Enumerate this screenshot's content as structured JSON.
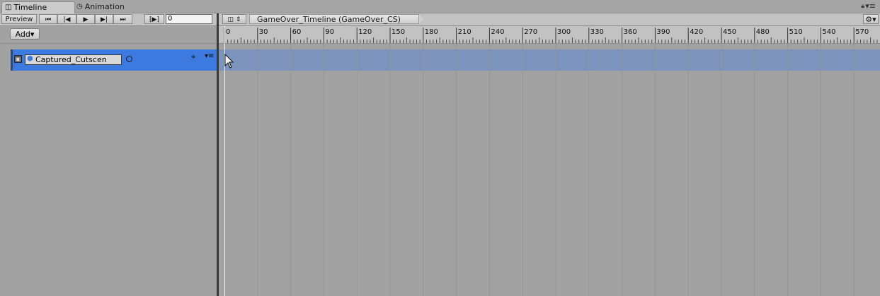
{
  "tabs": [
    {
      "label": "Timeline",
      "icon": "timeline-icon",
      "active": true
    },
    {
      "label": "Animation",
      "icon": "clock-icon",
      "active": false
    }
  ],
  "window": {
    "lock_icon": "lock-icon",
    "menu_icon": "window-menu-icon"
  },
  "toolbar": {
    "preview_label": "Preview",
    "frame_value": "0",
    "breadcrumb": "GameOver_Timeline (GameOver_CS)"
  },
  "left_pane": {
    "add_label": "Add▾",
    "track": {
      "name": "Captured_Cutscen",
      "selected": true
    }
  },
  "ruler": {
    "labels": [
      "0",
      "30",
      "60",
      "90",
      "120",
      "150",
      "180",
      "210",
      "240",
      "270",
      "300",
      "330",
      "360",
      "390",
      "420",
      "450",
      "480",
      "510",
      "540",
      "570"
    ],
    "playhead_frame": 0
  },
  "colors": {
    "track_selected": "#3d7ae0",
    "track_lane": "#7b93bd",
    "background": "#a2a2a2",
    "toolbar": "#c2c2c2"
  }
}
